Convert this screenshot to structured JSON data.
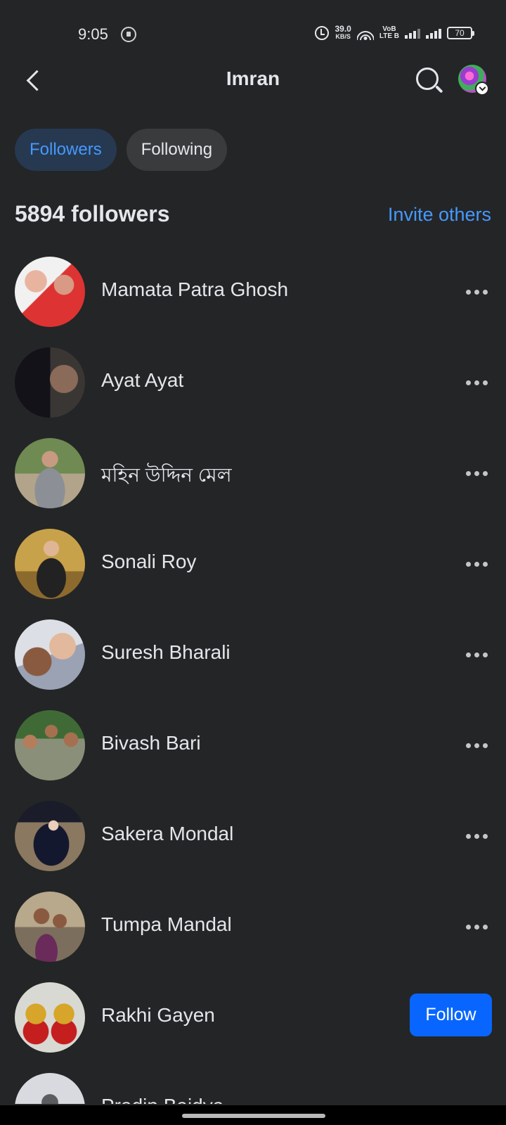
{
  "status_bar": {
    "time": "9:05",
    "net_speed_value": "39.0",
    "net_speed_unit": "KB/S",
    "volte_top": "VoB",
    "volte_bottom": "LTE B",
    "battery": "70"
  },
  "header": {
    "title": "Imran"
  },
  "tabs": [
    {
      "label": "Followers",
      "active": true
    },
    {
      "label": "Following",
      "active": false
    }
  ],
  "summary": {
    "count_label": "5894 followers",
    "invite_label": "Invite others"
  },
  "followers": [
    {
      "name": "Mamata Patra Ghosh",
      "action": "more"
    },
    {
      "name": "Ayat Ayat",
      "action": "more"
    },
    {
      "name": "মহিন উদ্দিন মেল",
      "action": "more"
    },
    {
      "name": "Sonali Roy",
      "action": "more"
    },
    {
      "name": "Suresh Bharali",
      "action": "more"
    },
    {
      "name": "Bivash Bari",
      "action": "more"
    },
    {
      "name": "Sakera Mondal",
      "action": "more"
    },
    {
      "name": "Tumpa Mandal",
      "action": "more"
    },
    {
      "name": "Rakhi Gayen",
      "action": "follow"
    },
    {
      "name": "Pradip Baidya",
      "action": "more"
    }
  ],
  "follow_label": "Follow",
  "colors": {
    "background": "#242526",
    "accent": "#4599ff",
    "follow_button": "#0866ff"
  }
}
